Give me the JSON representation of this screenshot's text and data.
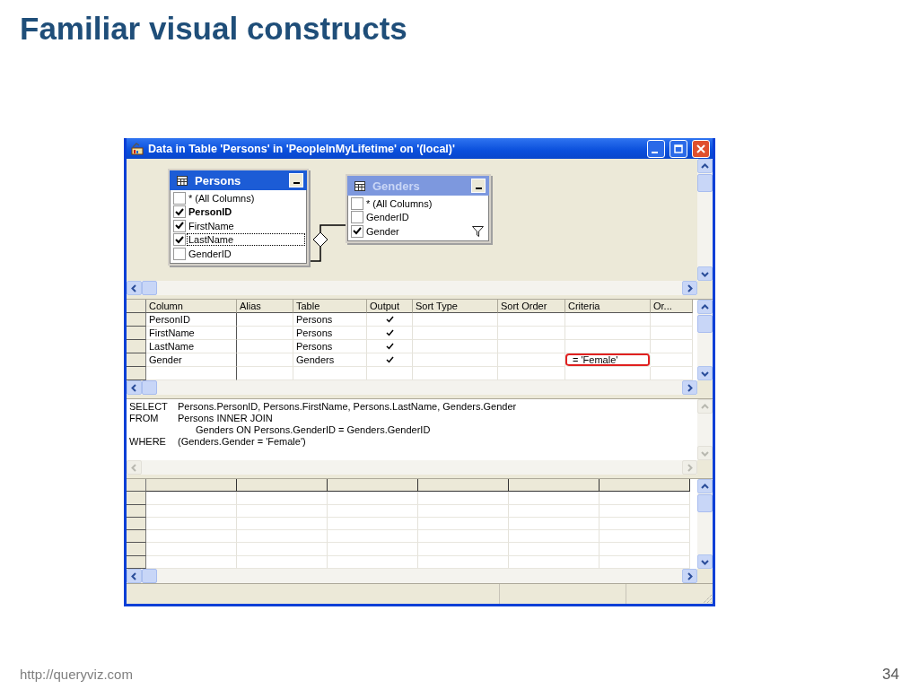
{
  "slide": {
    "title": "Familiar visual constructs",
    "footer": "http://queryviz.com",
    "page_number": "34"
  },
  "window": {
    "title": "Data in Table 'Persons' in 'PeopleInMyLifetime' on '(local)'"
  },
  "diagram": {
    "tables": [
      {
        "name": "Persons",
        "selected": true,
        "columns": [
          {
            "name": "* (All Columns)",
            "checked": false,
            "primary_key": false,
            "focused": false,
            "filtered": false
          },
          {
            "name": "PersonID",
            "checked": true,
            "primary_key": true,
            "focused": false,
            "filtered": false
          },
          {
            "name": "FirstName",
            "checked": true,
            "primary_key": false,
            "focused": false,
            "filtered": false
          },
          {
            "name": "LastName",
            "checked": true,
            "primary_key": false,
            "focused": true,
            "filtered": false
          },
          {
            "name": "GenderID",
            "checked": false,
            "primary_key": false,
            "focused": false,
            "filtered": false
          }
        ]
      },
      {
        "name": "Genders",
        "selected": false,
        "columns": [
          {
            "name": "* (All Columns)",
            "checked": false,
            "primary_key": false,
            "focused": false,
            "filtered": false
          },
          {
            "name": "GenderID",
            "checked": false,
            "primary_key": false,
            "focused": false,
            "filtered": false
          },
          {
            "name": "Gender",
            "checked": true,
            "primary_key": false,
            "focused": false,
            "filtered": true
          }
        ]
      }
    ]
  },
  "grid": {
    "columns": [
      "Column",
      "Alias",
      "Table",
      "Output",
      "Sort Type",
      "Sort Order",
      "Criteria",
      "Or..."
    ],
    "rows": [
      {
        "column": "PersonID",
        "table": "Persons",
        "output": true,
        "highlighted": false
      },
      {
        "column": "FirstName",
        "table": "Persons",
        "output": true,
        "highlighted": false
      },
      {
        "column": "LastName",
        "table": "Persons",
        "output": true,
        "highlighted": false
      },
      {
        "column": "Gender",
        "table": "Genders",
        "output": true,
        "criteria": "= 'Female'",
        "highlighted": true
      }
    ]
  },
  "sql": {
    "lines": [
      {
        "keyword": "SELECT",
        "text": "Persons.PersonID, Persons.FirstName, Persons.LastName, Genders.Gender"
      },
      {
        "keyword": "FROM",
        "text": "Persons INNER JOIN"
      },
      {
        "text": "Genders ON Persons.GenderID = Genders.GenderID"
      },
      {
        "keyword": "WHERE",
        "text": "(Genders.Gender = 'Female')"
      }
    ]
  }
}
